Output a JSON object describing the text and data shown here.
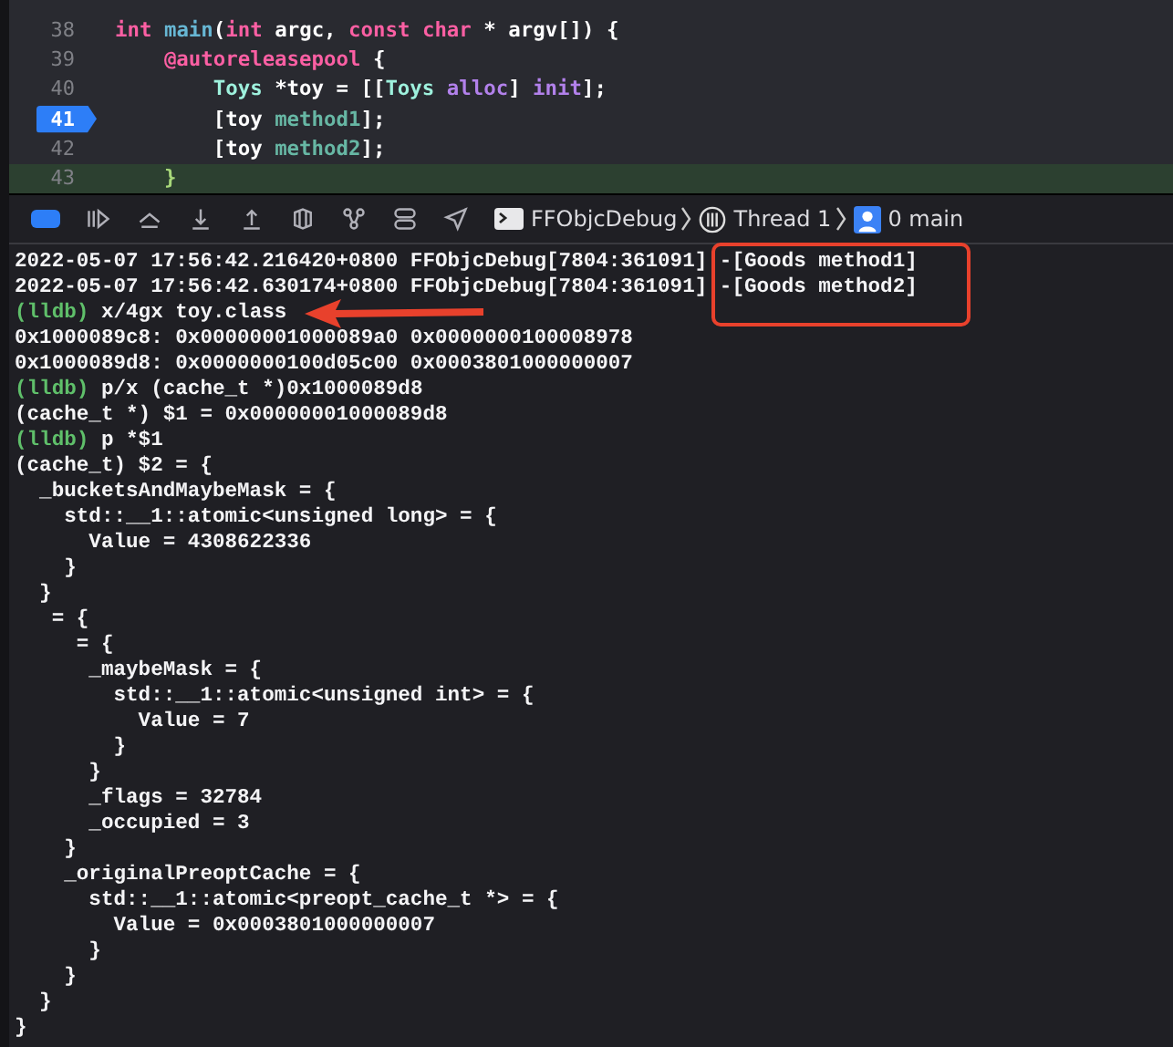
{
  "editor": {
    "lines": [
      {
        "number": "38",
        "breakpoint": false,
        "current": false,
        "tokens": [
          {
            "text": "int",
            "kind": "keyword"
          },
          {
            "text": " main",
            "kind": "function"
          },
          {
            "text": "(",
            "kind": "plain"
          },
          {
            "text": "int",
            "kind": "keyword"
          },
          {
            "text": " argc, ",
            "kind": "plain"
          },
          {
            "text": "const",
            "kind": "keyword"
          },
          {
            "text": " char",
            "kind": "keyword"
          },
          {
            "text": " * argv[]) {",
            "kind": "plain"
          }
        ]
      },
      {
        "number": "39",
        "breakpoint": false,
        "current": false,
        "tokens": [
          {
            "text": "    @autoreleasepool",
            "kind": "keyword"
          },
          {
            "text": " {",
            "kind": "plain"
          }
        ]
      },
      {
        "number": "40",
        "breakpoint": false,
        "current": false,
        "tokens": [
          {
            "text": "        Toys",
            "kind": "type"
          },
          {
            "text": " *toy = [[",
            "kind": "plain"
          },
          {
            "text": "Toys",
            "kind": "type"
          },
          {
            "text": " alloc",
            "kind": "method"
          },
          {
            "text": "] ",
            "kind": "plain"
          },
          {
            "text": "init",
            "kind": "method"
          },
          {
            "text": "];",
            "kind": "plain"
          }
        ]
      },
      {
        "number": "41",
        "breakpoint": true,
        "current": false,
        "tokens": [
          {
            "text": "        [toy ",
            "kind": "plain"
          },
          {
            "text": "method1",
            "kind": "project"
          },
          {
            "text": "];",
            "kind": "plain"
          }
        ]
      },
      {
        "number": "42",
        "breakpoint": false,
        "current": false,
        "tokens": [
          {
            "text": "        [toy ",
            "kind": "plain"
          },
          {
            "text": "method2",
            "kind": "project"
          },
          {
            "text": "];",
            "kind": "plain"
          }
        ]
      },
      {
        "number": "43",
        "breakpoint": false,
        "current": true,
        "tokens": [
          {
            "text": "    }",
            "kind": "brace"
          }
        ]
      }
    ]
  },
  "debug_bar": {
    "breadcrumbs": [
      {
        "label": "FFObjcDebug",
        "kind": "target"
      },
      {
        "label": "Thread 1",
        "kind": "thread"
      },
      {
        "label": "0 main",
        "kind": "frame"
      }
    ]
  },
  "console": {
    "lines": [
      {
        "text": "2022-05-07 17:56:42.216420+0800 FFObjcDebug[7804:361091] -[Goods method1]"
      },
      {
        "text": "2022-05-07 17:56:42.630174+0800 FFObjcDebug[7804:361091] -[Goods method2]"
      },
      {
        "prompt": "(lldb)",
        "text": "x/4gx toy.class"
      },
      {
        "text": "0x1000089c8: 0x00000001000089a0 0x0000000100008978"
      },
      {
        "text": "0x1000089d8: 0x0000000100d05c00 0x0003801000000007"
      },
      {
        "prompt": "(lldb)",
        "text": "p/x (cache_t *)0x1000089d8"
      },
      {
        "text": "(cache_t *) $1 = 0x00000001000089d8"
      },
      {
        "prompt": "(lldb)",
        "text": "p *$1"
      },
      {
        "text": "(cache_t) $2 = {"
      },
      {
        "text": "  _bucketsAndMaybeMask = {"
      },
      {
        "text": "    std::__1::atomic<unsigned long> = {"
      },
      {
        "text": "      Value = 4308622336"
      },
      {
        "text": "    }"
      },
      {
        "text": "  }"
      },
      {
        "text": "   = {"
      },
      {
        "text": "     = {"
      },
      {
        "text": "      _maybeMask = {"
      },
      {
        "text": "        std::__1::atomic<unsigned int> = {"
      },
      {
        "text": "          Value = 7"
      },
      {
        "text": "        }"
      },
      {
        "text": "      }"
      },
      {
        "text": "      _flags = 32784"
      },
      {
        "text": "      _occupied = 3"
      },
      {
        "text": "    }"
      },
      {
        "text": "    _originalPreoptCache = {"
      },
      {
        "text": "      std::__1::atomic<preopt_cache_t *> = {"
      },
      {
        "text": "        Value = 0x0003801000000007"
      },
      {
        "text": "      }"
      },
      {
        "text": "    }"
      },
      {
        "text": "  }"
      },
      {
        "text": "}"
      }
    ]
  }
}
